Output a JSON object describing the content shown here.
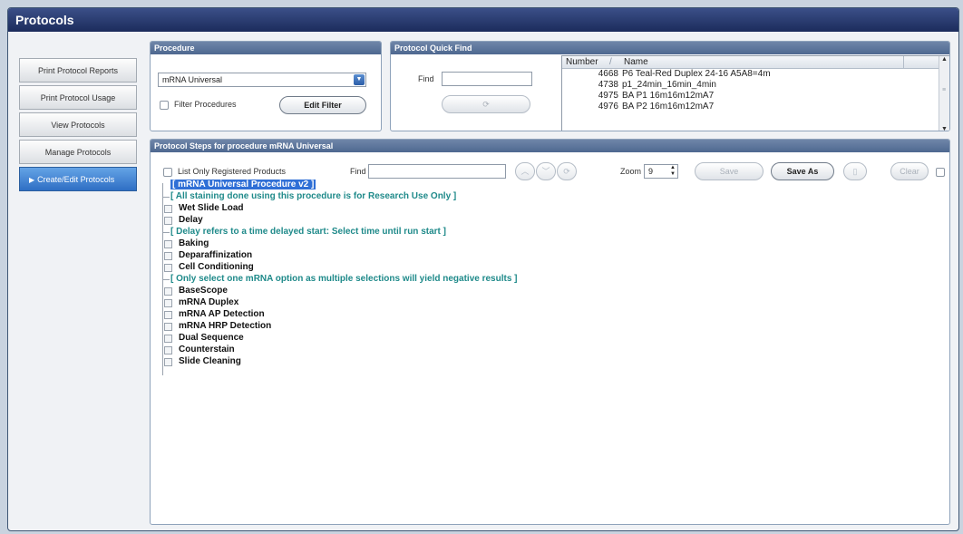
{
  "window": {
    "title": "Protocols"
  },
  "sidebar": {
    "items": [
      {
        "label": "Print Protocol Reports",
        "active": false
      },
      {
        "label": "Print Protocol Usage",
        "active": false
      },
      {
        "label": "View Protocols",
        "active": false
      },
      {
        "label": "Manage Protocols",
        "active": false
      },
      {
        "label": "Create/Edit Protocols",
        "active": true
      }
    ]
  },
  "procedure": {
    "header": "Procedure",
    "selected": "mRNA Universal",
    "filter_label": "Filter Procedures",
    "edit_filter_label": "Edit Filter"
  },
  "quick_find": {
    "header": "Protocol Quick Find",
    "find_label": "Find",
    "find_value": "",
    "columns": {
      "number": "Number",
      "name": "Name"
    },
    "rows": [
      {
        "number": "4668",
        "name": "P6 Teal-Red Duplex 24-16 A5A8=4m"
      },
      {
        "number": "4738",
        "name": "p1_24min_16min_4min"
      },
      {
        "number": "4975",
        "name": "BA P1 16m16m12mA7"
      },
      {
        "number": "4976",
        "name": "BA P2 16m16m12mA7"
      }
    ]
  },
  "steps": {
    "header": "Protocol Steps for procedure mRNA Universal",
    "list_only_label": "List Only Registered Products",
    "find_label": "Find",
    "find_value": "",
    "zoom_label": "Zoom",
    "zoom_value": "9",
    "save_label": "Save",
    "save_as_label": "Save As",
    "clear_label": "Clear",
    "tree": [
      {
        "kind": "title",
        "text": "[ mRNA Universal Procedure v2 ]"
      },
      {
        "kind": "note",
        "text": "[ All staining done using this procedure is for Research Use Only ]"
      },
      {
        "kind": "step",
        "text": "Wet Slide Load"
      },
      {
        "kind": "step",
        "text": "Delay"
      },
      {
        "kind": "note",
        "text": "[ Delay refers to a time delayed start: Select time until run start ]"
      },
      {
        "kind": "step",
        "text": "Baking"
      },
      {
        "kind": "step",
        "text": "Deparaffinization"
      },
      {
        "kind": "step",
        "text": "Cell Conditioning"
      },
      {
        "kind": "note",
        "text": "[ Only select one mRNA option as multiple selections will yield negative results ]"
      },
      {
        "kind": "step",
        "text": "BaseScope"
      },
      {
        "kind": "step",
        "text": "mRNA Duplex"
      },
      {
        "kind": "step",
        "text": "mRNA AP Detection"
      },
      {
        "kind": "step",
        "text": "mRNA HRP Detection"
      },
      {
        "kind": "step",
        "text": "Dual Sequence"
      },
      {
        "kind": "step",
        "text": "Counterstain"
      },
      {
        "kind": "step",
        "text": "Slide Cleaning"
      }
    ]
  }
}
